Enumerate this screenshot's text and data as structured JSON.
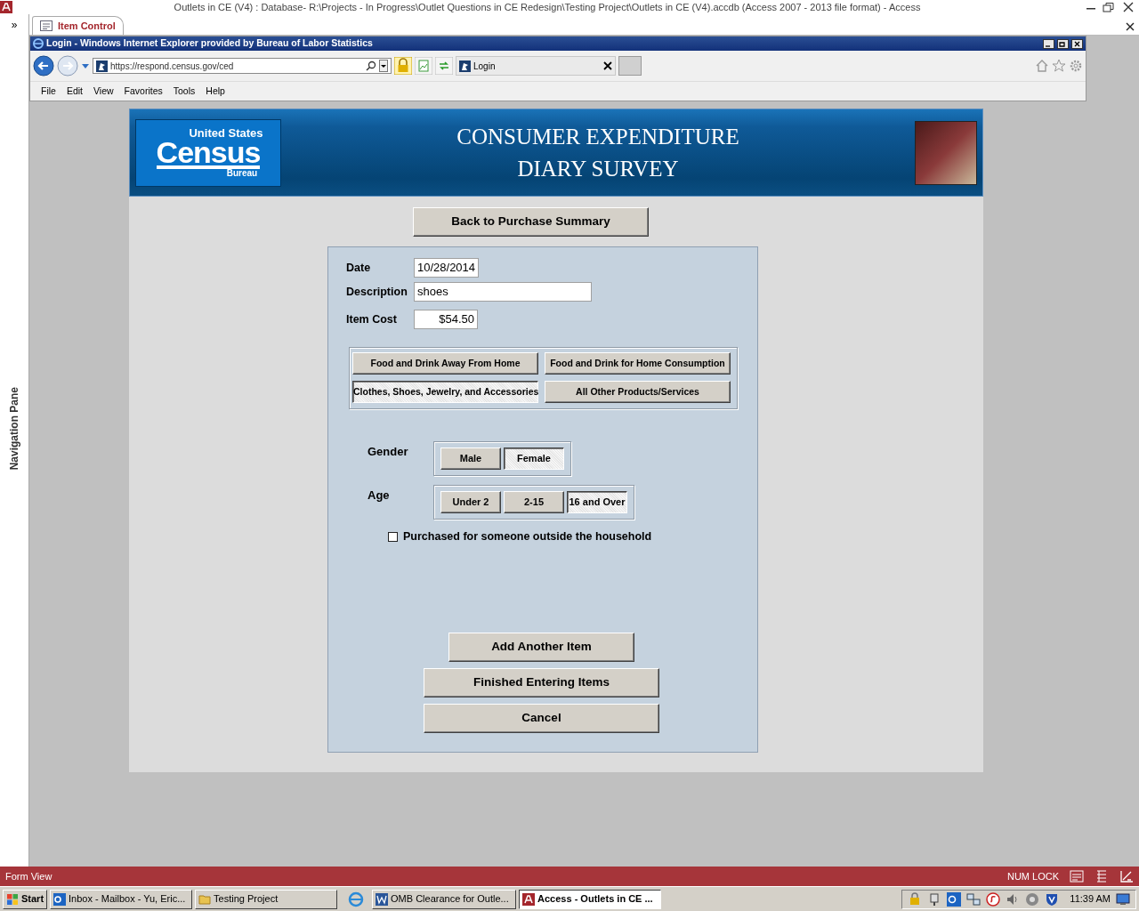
{
  "app_window": {
    "title": "Outlets in CE (V4) : Database- R:\\Projects - In Progress\\Outlet Questions in CE Redesign\\Testing Project\\Outlets in CE (V4).accdb (Access 2007 - 2013 file format) - Access"
  },
  "navigation_pane": {
    "toggle": "»",
    "label": "Navigation Pane"
  },
  "document_tab": {
    "label": "Item Control"
  },
  "browser": {
    "title": "Login - Windows Internet Explorer provided by Bureau of Labor Statistics",
    "address": "https://respond.census.gov/ced",
    "tab_label": "Login",
    "menu": [
      "File",
      "Edit",
      "View",
      "Favorites",
      "Tools",
      "Help"
    ]
  },
  "header": {
    "logo": [
      "United States",
      "Census",
      "Bureau"
    ],
    "title_lines": [
      "CONSUMER EXPENDITURE",
      "DIARY SURVEY"
    ]
  },
  "back_button": "Back to Purchase Summary",
  "fields": [
    {
      "label": "Date",
      "value": "10/28/2014",
      "kind": "short"
    },
    {
      "label": "Description",
      "value": "shoes",
      "kind": "long"
    },
    {
      "label": "Item Cost",
      "value": "$54.50",
      "kind": "money"
    }
  ],
  "categories": [
    {
      "label": "Food and Drink Away From Home",
      "selected": false
    },
    {
      "label": "Food and Drink for Home Consumption",
      "selected": false
    },
    {
      "label": "Clothes, Shoes, Jewelry, and Accessories",
      "selected": true
    },
    {
      "label": "All Other Products/Services",
      "selected": false
    }
  ],
  "gender": {
    "label": "Gender",
    "options": [
      {
        "label": "Male",
        "selected": false
      },
      {
        "label": "Female",
        "selected": true
      }
    ]
  },
  "age": {
    "label": "Age",
    "options": [
      {
        "label": "Under 2",
        "selected": false
      },
      {
        "label": "2-15",
        "selected": false
      },
      {
        "label": "16 and Over",
        "selected": true
      }
    ]
  },
  "outside_household": {
    "label": "Purchased for someone outside the household",
    "checked": false
  },
  "actions": [
    "Add Another Item",
    "Finished Entering Items",
    "Cancel"
  ],
  "status_bar": {
    "mode": "Form View",
    "indicator": "NUM LOCK"
  },
  "taskbar": {
    "start": "Start",
    "items": [
      {
        "label": "Inbox - Mailbox - Yu, Eric...",
        "selected": false
      },
      {
        "label": "Testing Project",
        "selected": false
      },
      {
        "label": "OMB Clearance for Outle...",
        "selected": false
      },
      {
        "label": "Access - Outlets in CE ...",
        "selected": true
      }
    ],
    "clock": "11:39 AM"
  }
}
